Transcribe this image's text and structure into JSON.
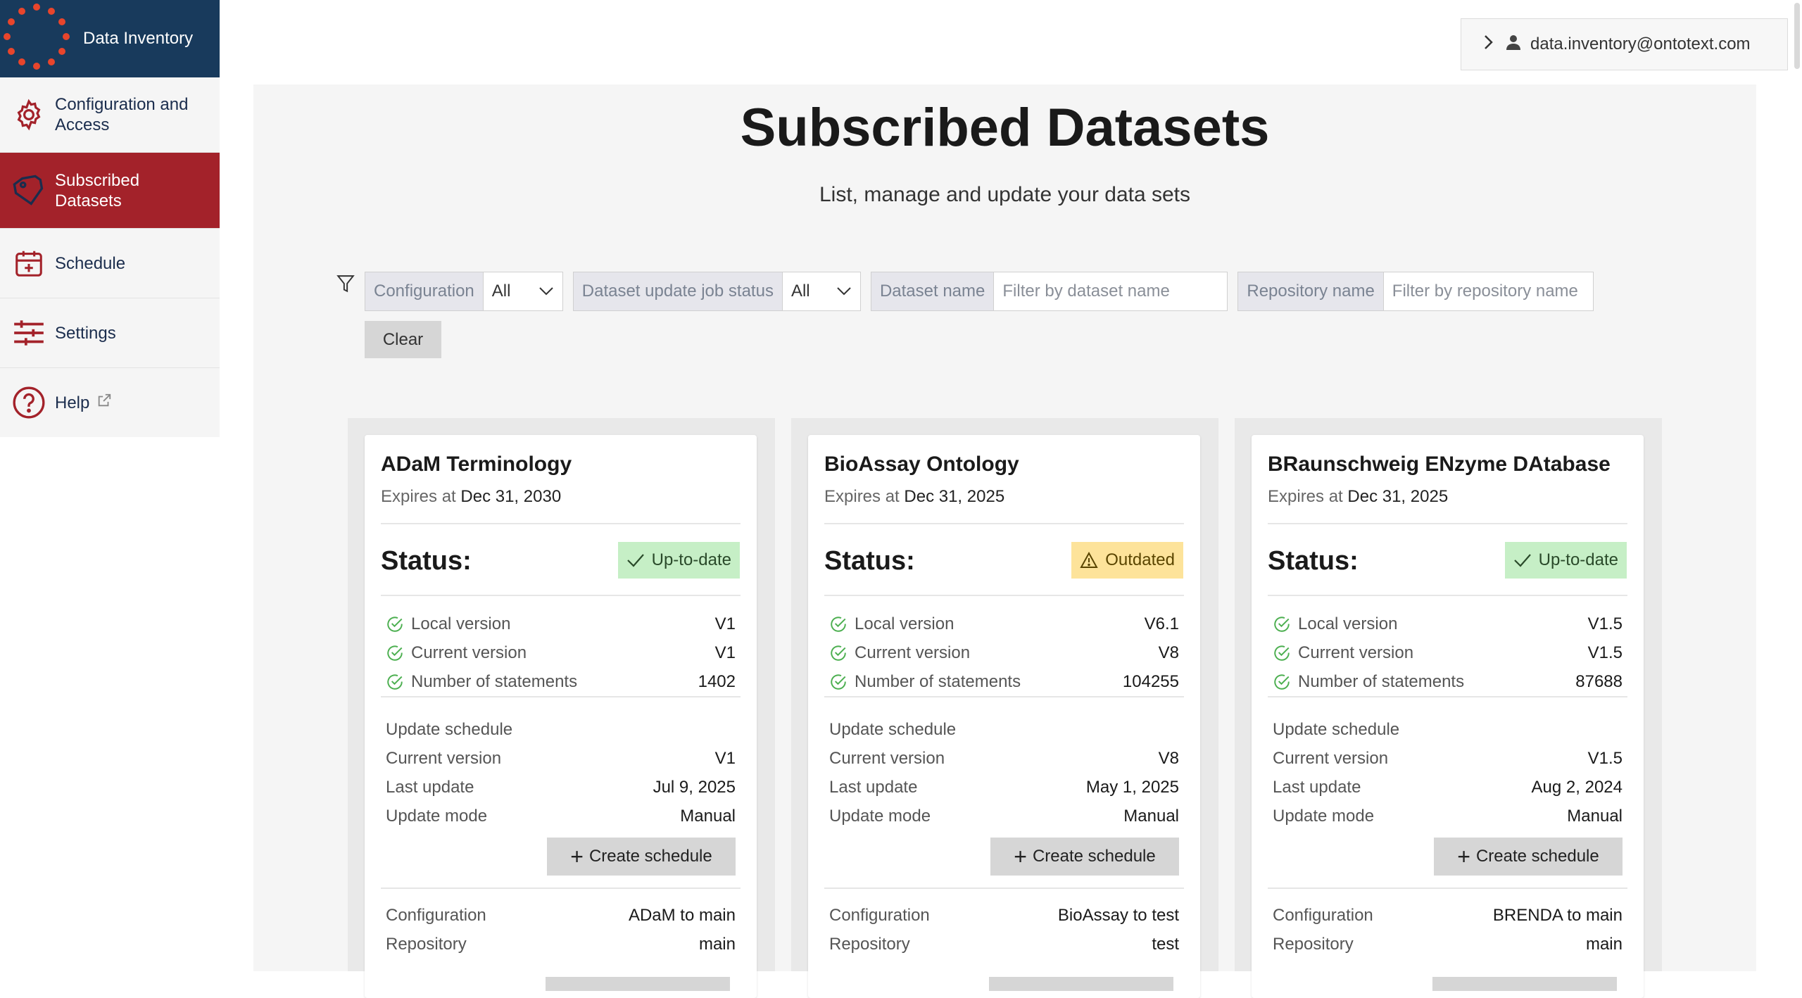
{
  "app": {
    "title": "Data Inventory"
  },
  "sidebar": {
    "items": [
      {
        "label": "Configuration and Access",
        "icon": "gear-icon"
      },
      {
        "label": "Subscribed Datasets",
        "icon": "tag-icon"
      },
      {
        "label": "Schedule",
        "icon": "calendar-icon"
      },
      {
        "label": "Settings",
        "icon": "sliders-icon"
      },
      {
        "label": "Help",
        "icon": "help-icon"
      }
    ]
  },
  "user": {
    "email": "data.inventory@ontotext.com"
  },
  "page": {
    "title": "Subscribed Datasets",
    "subtitle": "List, manage and update your data sets"
  },
  "filters": {
    "configuration": {
      "label": "Configuration",
      "value": "All"
    },
    "job_status": {
      "label": "Dataset update job status",
      "value": "All"
    },
    "dataset_name": {
      "label": "Dataset name",
      "placeholder": "Filter by dataset name"
    },
    "repository_name": {
      "label": "Repository name",
      "placeholder": "Filter by repository name"
    },
    "clear_label": "Clear"
  },
  "card_labels": {
    "expires_at": "Expires at",
    "status": "Status:",
    "local_version": "Local version",
    "current_version": "Current version",
    "number_of_statements": "Number of statements",
    "update_schedule": "Update schedule",
    "last_update": "Last update",
    "update_mode": "Update mode",
    "create_schedule": "Create schedule",
    "configuration": "Configuration",
    "repository": "Repository"
  },
  "datasets": [
    {
      "name": "ADaM Terminology",
      "expires": "Dec 31, 2030",
      "status": "Up-to-date",
      "local_version": "V1",
      "current_version": "V1",
      "statements": "1402",
      "schedule_current_version": "V1",
      "last_update": "Jul 9, 2025",
      "update_mode": "Manual",
      "configuration": "ADaM to main",
      "repository": "main"
    },
    {
      "name": "BioAssay Ontology",
      "expires": "Dec 31, 2025",
      "status": "Outdated",
      "local_version": "V6.1",
      "current_version": "V8",
      "statements": "104255",
      "schedule_current_version": "V8",
      "last_update": "May 1, 2025",
      "update_mode": "Manual",
      "configuration": "BioAssay to test",
      "repository": "test"
    },
    {
      "name": "BRaunschweig ENzyme DAtabase",
      "expires": "Dec 31, 2025",
      "status": "Up-to-date",
      "local_version": "V1.5",
      "current_version": "V1.5",
      "statements": "87688",
      "schedule_current_version": "V1.5",
      "last_update": "Aug 2, 2024",
      "update_mode": "Manual",
      "configuration": "BRENDA to main",
      "repository": "main"
    }
  ],
  "colors": {
    "brand_bg": "#183a5c",
    "active_nav": "#a3222a",
    "logo_dots": "#e8452c",
    "ok_badge": "#c6efc6",
    "warn_badge": "#fde39a",
    "check_green": "#4caf50"
  }
}
